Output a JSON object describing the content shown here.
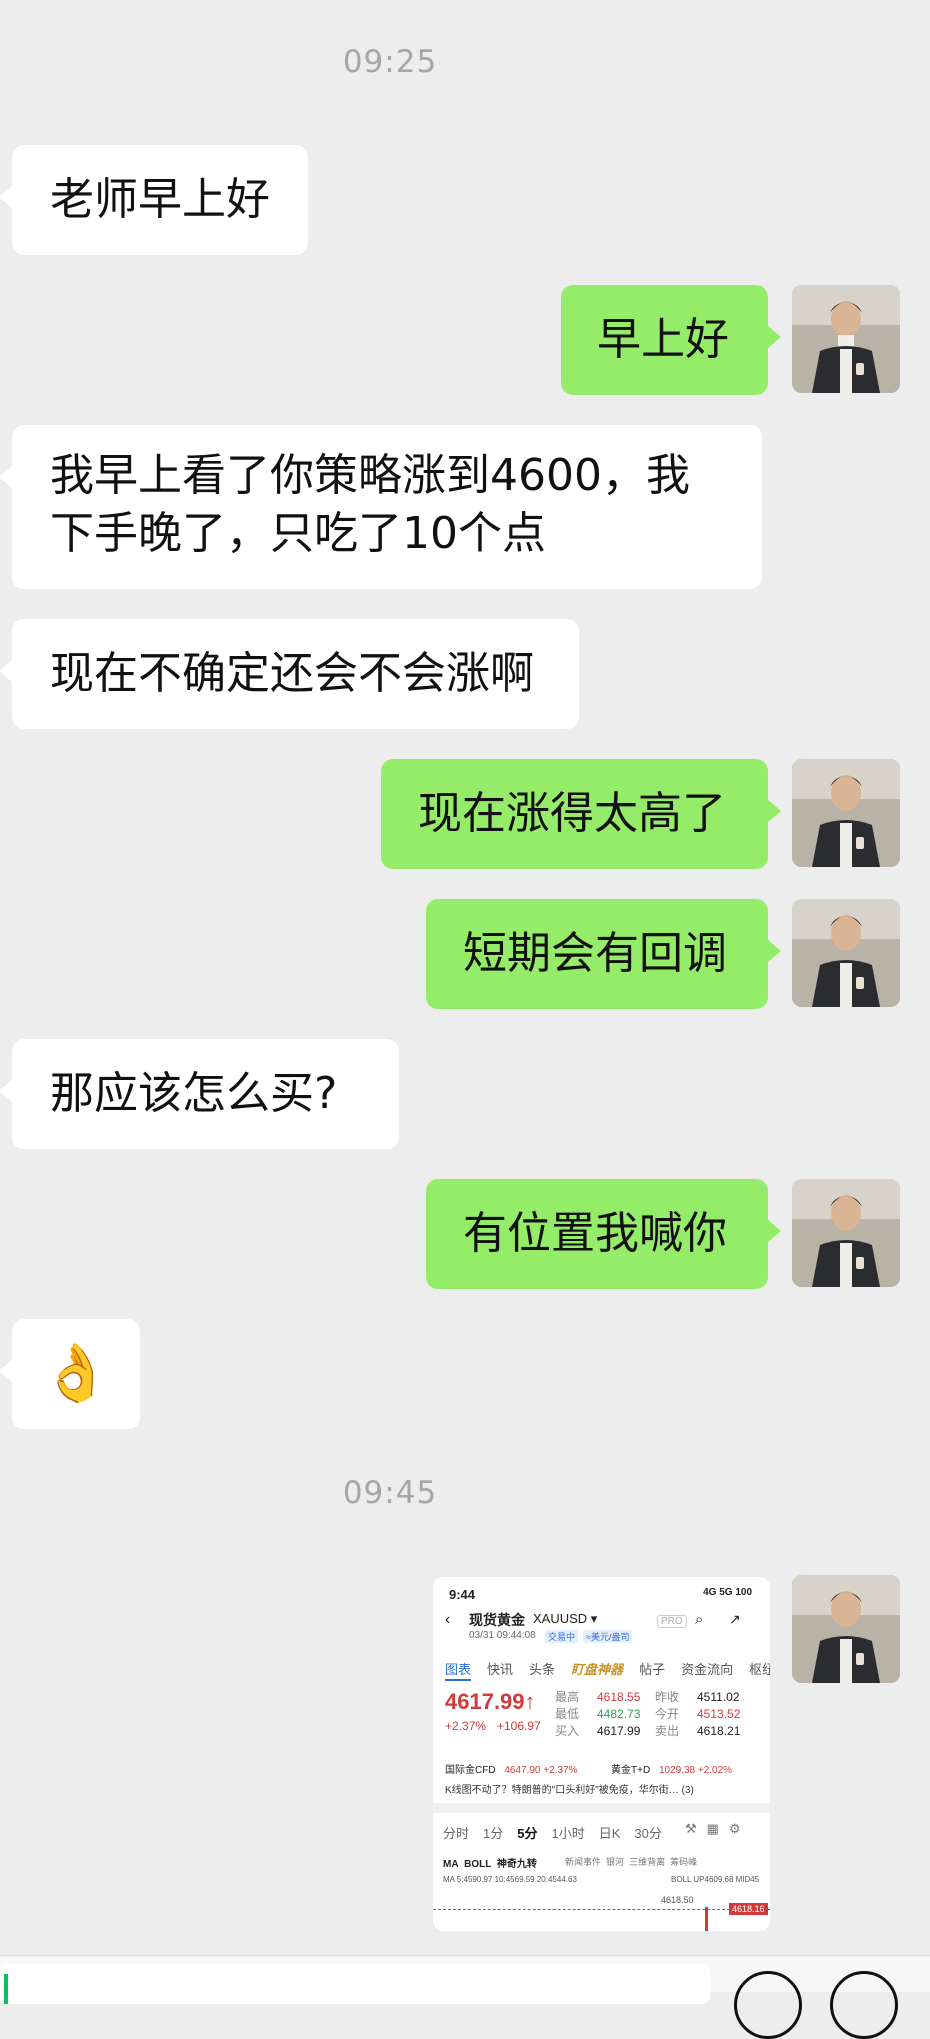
{
  "timestamps": [
    "09:25",
    "09:45"
  ],
  "messages": [
    {
      "side": "in",
      "text": "老师早上好"
    },
    {
      "side": "out",
      "text": "早上好"
    },
    {
      "side": "in",
      "lines": [
        "我早上看了你策略涨到4600，我",
        "下手晚了，只吃了10个点"
      ]
    },
    {
      "side": "in",
      "text": "现在不确定还会不会涨啊"
    },
    {
      "side": "out",
      "text": "现在涨得太高了"
    },
    {
      "side": "out",
      "text": "短期会有回调"
    },
    {
      "side": "in",
      "text": "那应该怎么买?"
    },
    {
      "side": "out",
      "text": "有位置我喊你"
    },
    {
      "side": "in",
      "emoji": "👌"
    }
  ],
  "screenshot": {
    "status_time": "9:44",
    "status_right": "4G 5G 100",
    "title": "现货黄金",
    "symbol": "XAUUSD ▾",
    "datetime": "03/31 09:44:08",
    "status_tag": "交易中",
    "unit_tag": "≈美元/盎司",
    "pro": "PRO",
    "tabs": [
      "图表",
      "快讯",
      "头条",
      "盯盘神器",
      "帖子",
      "资金流向",
      "枢纽点"
    ],
    "price": "4617.99↑",
    "change_pct": "+2.37%",
    "change_abs": "+106.97",
    "stats": [
      {
        "label": "最高",
        "value": "4618.55",
        "label2": "昨收",
        "value2": "4511.02"
      },
      {
        "label": "最低",
        "value": "4482.73",
        "label2": "今开",
        "value2": "4513.52"
      },
      {
        "label": "买入",
        "value": "4617.99",
        "label2": "卖出",
        "value2": "4618.21"
      }
    ],
    "related_left_label": "国际金CFD",
    "related_left_value": "4647.90 +2.37%",
    "related_right_label": "黄金T+D",
    "related_right_value": "1029.38 +2.02%",
    "news": "K线图不动了？特朗普的\"口头利好\"被免疫，华尔街…  (3)",
    "timeframes": [
      "分时",
      "1分",
      "5分",
      "1小时",
      "日K",
      "30分"
    ],
    "selected_timeframe": "5分",
    "indicators": [
      "MA",
      "BOLL",
      "神奇九转"
    ],
    "indicators_right": [
      "新闻事件",
      "银河",
      "三维背离",
      "筹码峰"
    ],
    "ma_line": "MA 5:4590.97 10:4569.59 20:4544.63",
    "boll_line": "BOLL UP4609.68 MID45",
    "level_label": "4618.50",
    "price_tag": "4618.16"
  },
  "colors": {
    "incoming": "#ffffff",
    "outgoing": "#95ec69",
    "background": "#ededed"
  }
}
